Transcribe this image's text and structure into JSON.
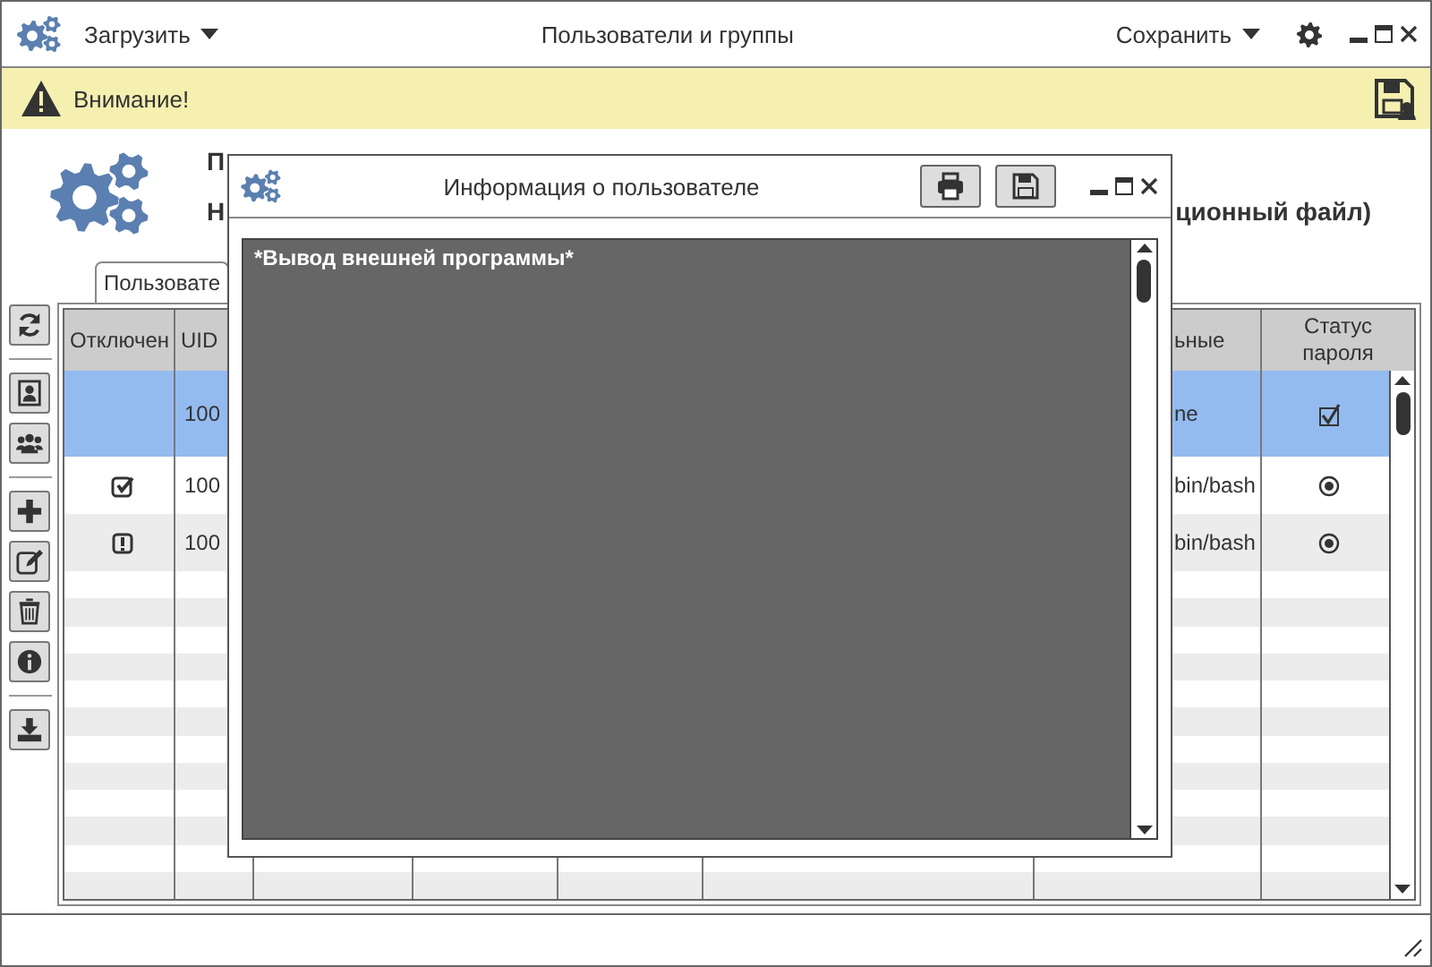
{
  "window": {
    "title": "Пользователи и группы",
    "menus": [
      {
        "label": "Загрузить"
      },
      {
        "label": "Сохранить"
      }
    ]
  },
  "warning": {
    "text": "Внимание!"
  },
  "header": {
    "line_1": "П",
    "line_2": "Н",
    "line_2_end": "ционный файл)"
  },
  "tabs": [
    {
      "label": "Пользовате",
      "selected": true
    }
  ],
  "table": {
    "columns": [
      {
        "label": "Отключен"
      },
      {
        "label": "UID"
      },
      {
        "label": "ьные"
      },
      {
        "label": "Статус пароля"
      }
    ],
    "rows": [
      {
        "selected": true,
        "uid": "100",
        "column_7": "ne",
        "password": {
          "kind": "checkbox",
          "checked": true
        }
      },
      {
        "selected": false,
        "disabled": {
          "kind": "check"
        },
        "uid": "100",
        "column_7": "bin/bash",
        "password": {
          "kind": "radio",
          "selected": true
        }
      },
      {
        "selected": false,
        "disabled": {
          "kind": "alert"
        },
        "uid": "100",
        "column_7": "bin/bash",
        "password": {
          "kind": "radio",
          "selected": true
        }
      }
    ]
  },
  "dialog": {
    "title": "Информация о пользователе",
    "output": "*Вывод внешней программы*"
  }
}
